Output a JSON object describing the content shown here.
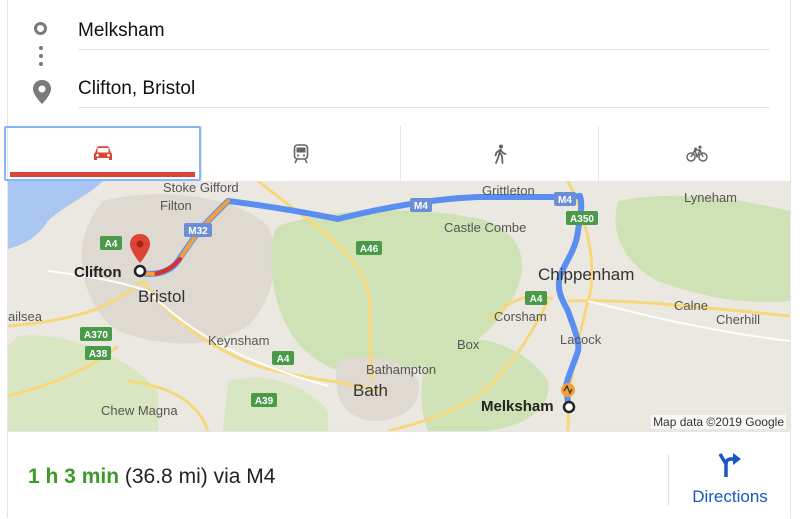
{
  "route": {
    "origin": "Melksham",
    "destination": "Clifton, Bristol"
  },
  "tabs": [
    {
      "name": "tab-driving",
      "icon": "car-icon",
      "active": true
    },
    {
      "name": "tab-transit",
      "icon": "train-icon",
      "active": false
    },
    {
      "name": "tab-walking",
      "icon": "walking-icon",
      "active": false
    },
    {
      "name": "tab-cycling",
      "icon": "bicycle-icon",
      "active": false
    }
  ],
  "map": {
    "places": {
      "stoke_gifford": "Stoke Gifford",
      "filton": "Filton",
      "grittleton": "Grittleton",
      "lyneham": "Lyneham",
      "clifton": "Clifton",
      "bristol": "Bristol",
      "castle_combe": "Castle Combe",
      "chippenham": "Chippenham",
      "nailsea": "ailsea",
      "keynsham": "Keynsham",
      "corsham": "Corsham",
      "calne": "Calne",
      "cherhill": "Cherhill",
      "box": "Box",
      "lacock": "Lacock",
      "bathampton": "Bathampton",
      "bath": "Bath",
      "chew_magna": "Chew Magna",
      "melksham": "Melksham"
    },
    "roads": {
      "m32": "M32",
      "m4_a": "M4",
      "m4_b": "M4",
      "a350": "A350",
      "a46": "A46",
      "a4_west": "A4",
      "a4_east": "A4",
      "a4_south": "A4",
      "a370": "A370",
      "a38": "A38",
      "a39": "A39"
    },
    "attribution": "Map data ©2019 Google"
  },
  "summary": {
    "duration": "1 h 3 min",
    "distance": "(36.8 mi)",
    "via": "via M4"
  },
  "directions_label": "Directions",
  "colors": {
    "route_blue": "#5a8ef0",
    "traffic_orange": "#f2a13a",
    "traffic_red": "#d93025",
    "accent_red": "#db4437",
    "duration_green": "#3c9a28",
    "link_blue": "#1a56c4",
    "park_green": "#cfe2b5"
  }
}
